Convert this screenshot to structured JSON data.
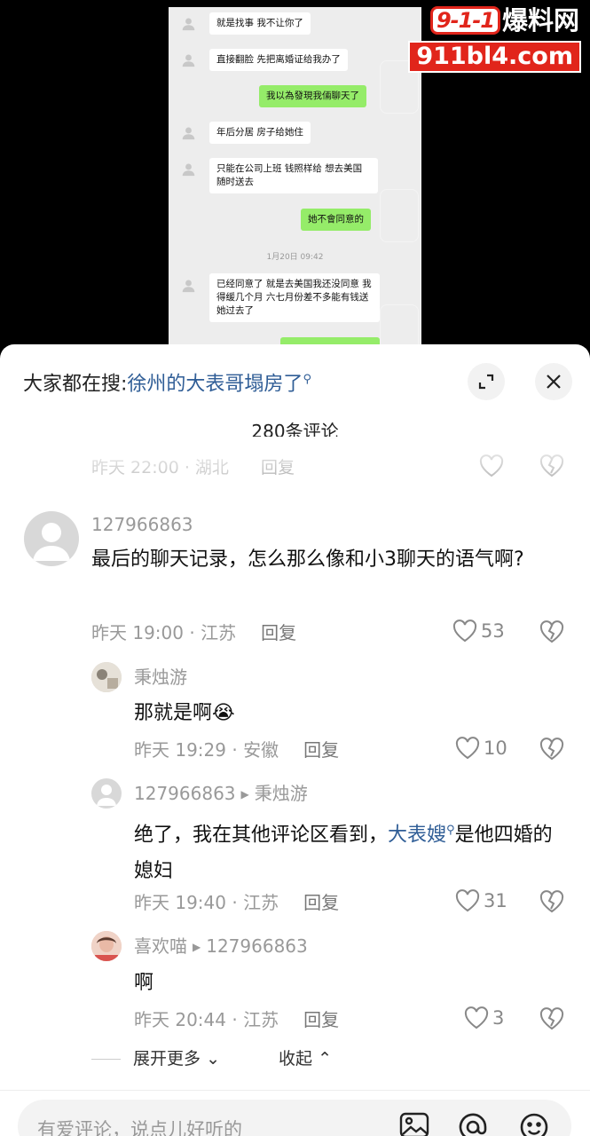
{
  "chat_screenshot": {
    "messages": [
      {
        "side": "left",
        "text": "就是找事 我不让你了"
      },
      {
        "side": "left",
        "text": "直接翻脸 先把离婚证给我办了"
      },
      {
        "side": "right",
        "text": "我以為發現我倆聊天了"
      },
      {
        "side": "left",
        "text": "年后分居 房子给她住"
      },
      {
        "side": "left",
        "text": "只能在公司上班 钱照样给 想去美国随时送去"
      },
      {
        "side": "right",
        "text": "她不會同意的"
      },
      {
        "side": "left",
        "text": "已经同意了 就是去美国我还没同意 我得缓几个月 六七月份差不多能有钱送她过去了"
      }
    ],
    "timestamp": "1月20日 09:42"
  },
  "watermark": {
    "badge": "9-1-1",
    "name": "爆料网",
    "url": "911bl4.com"
  },
  "panel": {
    "search_prefix": "大家都在搜:",
    "search_keyword": "徐州的大表哥塌房了",
    "comment_count": "280条评论",
    "partial_row": {
      "meta": "昨天 22:00 · 湖北",
      "reply": "回复"
    },
    "comments": [
      {
        "user": "127966863",
        "text": "最后的聊天记录，怎么那么像和小3聊天的语气啊?",
        "time": "昨天 19:00 · 江苏",
        "reply": "回复",
        "likes": "53"
      }
    ],
    "replies": [
      {
        "user": "秉烛游",
        "text": "那就是啊",
        "emoji": "😭",
        "time": "昨天 19:29 · 安徽",
        "reply": "回复",
        "likes": "10"
      },
      {
        "user": "127966863",
        "to": "秉烛游",
        "text_before": "绝了，我在其他评论区看到，",
        "keyword": "大表嫂",
        "text_after": "是他四婚的媳妇",
        "time": "昨天 19:40 · 江苏",
        "reply": "回复",
        "likes": "31"
      },
      {
        "user": "喜欢喵",
        "to": "127966863",
        "text": "啊",
        "time": "昨天 20:44 · 江苏",
        "reply": "回复",
        "likes": "3"
      }
    ],
    "expand_more": "展开更多",
    "collapse": "收起",
    "input_placeholder": "有爱评论，说点儿好听的"
  },
  "icons": {
    "expand": "expand-icon",
    "close": "close-icon",
    "heart": "heart-icon",
    "dislike": "broken-heart-icon",
    "image": "image-icon",
    "at": "at-icon",
    "emoji": "emoji-icon",
    "search": "search-icon"
  }
}
